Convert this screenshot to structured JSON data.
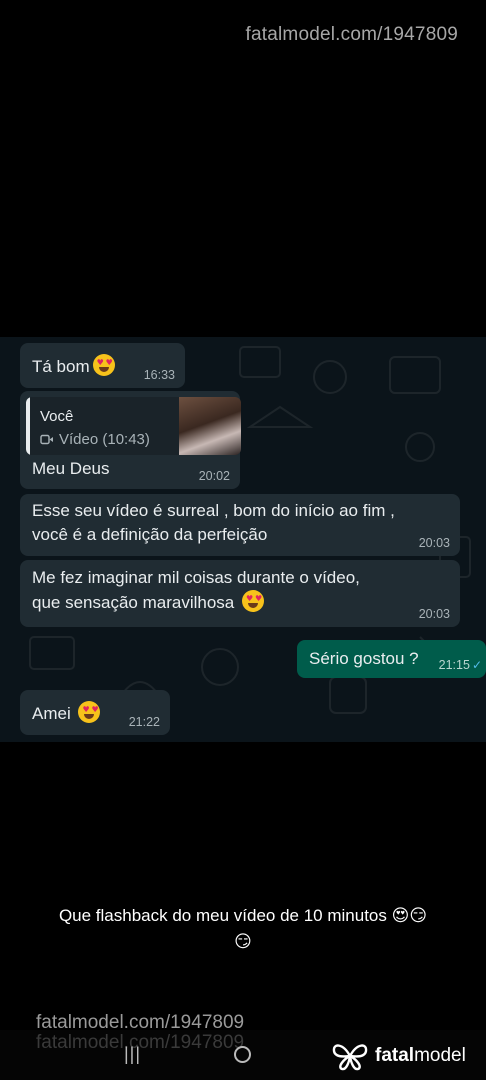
{
  "watermark": {
    "url": "fatalmodel.com/1947809"
  },
  "messages": [
    {
      "text": "Tá bom",
      "time": "16:33"
    },
    {
      "quote_author": "Você",
      "quote_media": "Vídeo (10:43)",
      "text": "Meu Deus",
      "time": "20:02"
    },
    {
      "line1": "Esse seu vídeo é surreal , bom do início ao fim ,",
      "line2": "você é a definição da perfeição",
      "time": "20:03"
    },
    {
      "line1": "Me fez imaginar mil coisas  durante o vídeo,",
      "line2": "que sensação maravilhosa",
      "time": "20:03"
    },
    {
      "text": "Sério gostou ?",
      "time": "21:15"
    },
    {
      "text": "Amei",
      "time": "21:22"
    }
  ],
  "caption": {
    "line1": "Que flashback do meu vídeo de 10 minutos 😍😏",
    "line2": "😏"
  },
  "brand": {
    "name_bold": "fatal",
    "name_rest": "model"
  },
  "icons": {
    "video": "video-camera-icon",
    "read": "double-check-icon",
    "heart_eyes": "heart-eyes-emoji",
    "smiling_hearts": "smiling-face-with-hearts-emoji",
    "recents": "recents-icon",
    "home": "home-icon",
    "brand_logo": "butterfly-logo"
  }
}
